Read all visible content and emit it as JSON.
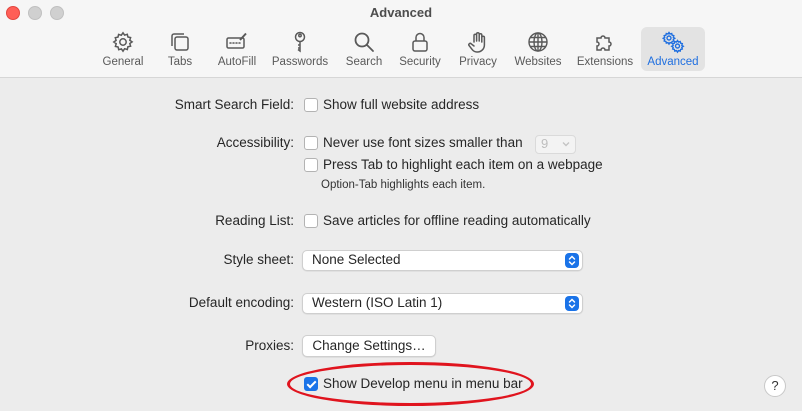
{
  "window": {
    "title": "Advanced"
  },
  "tabs": [
    {
      "label": "General",
      "icon": "gear-icon"
    },
    {
      "label": "Tabs",
      "icon": "tabs-icon"
    },
    {
      "label": "AutoFill",
      "icon": "autofill-icon"
    },
    {
      "label": "Passwords",
      "icon": "key-icon"
    },
    {
      "label": "Search",
      "icon": "search-icon"
    },
    {
      "label": "Security",
      "icon": "lock-icon"
    },
    {
      "label": "Privacy",
      "icon": "hand-icon"
    },
    {
      "label": "Websites",
      "icon": "globe-icon"
    },
    {
      "label": "Extensions",
      "icon": "puzzle-icon"
    },
    {
      "label": "Advanced",
      "icon": "gears-icon",
      "active": true
    }
  ],
  "settings": {
    "smart_search_label": "Smart Search Field:",
    "show_full_address": "Show full website address",
    "accessibility_label": "Accessibility:",
    "never_use_font_sizes": "Never use font sizes smaller than",
    "font_size_value": "9",
    "press_tab": "Press Tab to highlight each item on a webpage",
    "option_tab_note": "Option-Tab highlights each item.",
    "reading_list_label": "Reading List:",
    "save_articles": "Save articles for offline reading automatically",
    "style_sheet_label": "Style sheet:",
    "style_sheet_value": "None Selected",
    "default_encoding_label": "Default encoding:",
    "default_encoding_value": "Western (ISO Latin 1)",
    "proxies_label": "Proxies:",
    "change_settings_button": "Change Settings…",
    "show_develop_menu": "Show Develop menu in menu bar",
    "help_button": "?"
  },
  "colors": {
    "accent": "#1a73e8",
    "highlight_ring": "#e0141e"
  }
}
